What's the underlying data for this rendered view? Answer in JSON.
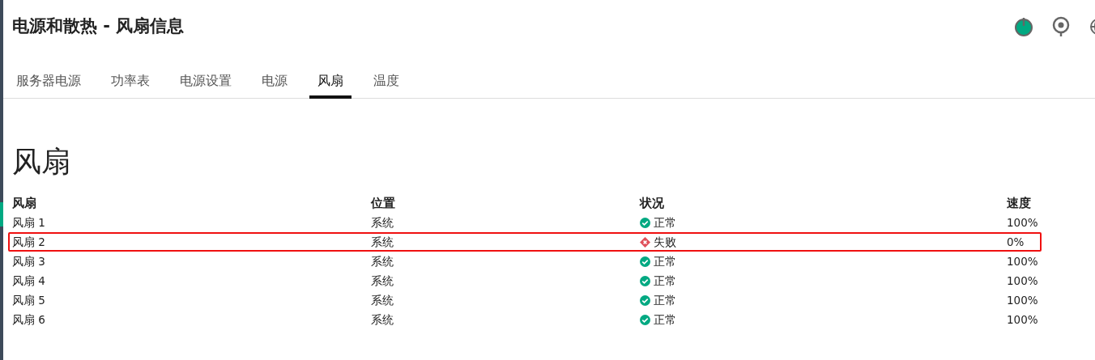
{
  "page_title": "电源和散热 - 风扇信息",
  "tabs": [
    {
      "label": "服务器电源",
      "selected": false
    },
    {
      "label": "功率表",
      "selected": false
    },
    {
      "label": "电源设置",
      "selected": false
    },
    {
      "label": "电源",
      "selected": false
    },
    {
      "label": "风扇",
      "selected": true
    },
    {
      "label": "温度",
      "selected": false
    }
  ],
  "section_title": "风扇",
  "table": {
    "columns": [
      "风扇",
      "位置",
      "状况",
      "速度"
    ],
    "rows": [
      {
        "fan": "风扇 1",
        "location": "系统",
        "status": {
          "kind": "ok",
          "label": "正常"
        },
        "speed": "100%",
        "highlighted": false
      },
      {
        "fan": "风扇 2",
        "location": "系统",
        "status": {
          "kind": "failed",
          "label": "失败"
        },
        "speed": "0%",
        "highlighted": true
      },
      {
        "fan": "风扇 3",
        "location": "系统",
        "status": {
          "kind": "ok",
          "label": "正常"
        },
        "speed": "100%",
        "highlighted": false
      },
      {
        "fan": "风扇 4",
        "location": "系统",
        "status": {
          "kind": "ok",
          "label": "正常"
        },
        "speed": "100%",
        "highlighted": false
      },
      {
        "fan": "风扇 5",
        "location": "系统",
        "status": {
          "kind": "ok",
          "label": "正常"
        },
        "speed": "100%",
        "highlighted": false
      },
      {
        "fan": "风扇 6",
        "location": "系统",
        "status": {
          "kind": "ok",
          "label": "正常"
        },
        "speed": "100%",
        "highlighted": false
      }
    ]
  }
}
